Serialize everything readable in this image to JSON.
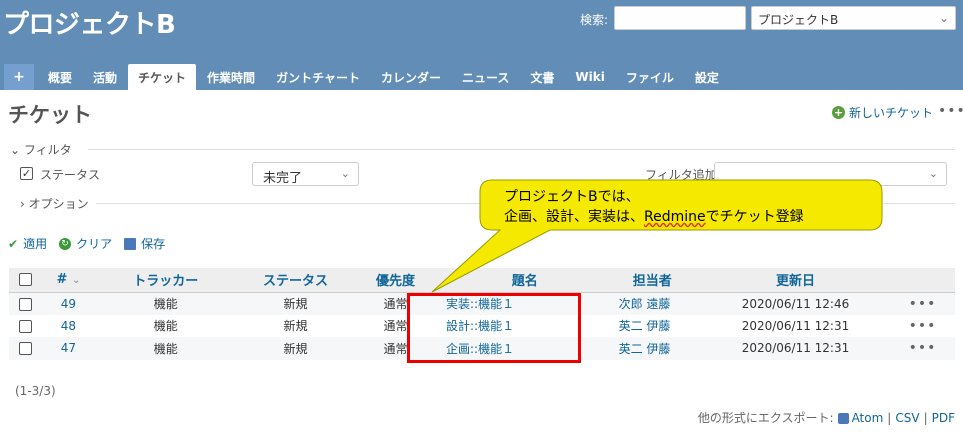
{
  "header": {
    "project_title": "プロジェクトB",
    "search_label": "検索:",
    "search_placeholder": "",
    "project_selector_value": "プロジェクトB"
  },
  "tabs": [
    {
      "label": "+"
    },
    {
      "label": "概要"
    },
    {
      "label": "活動"
    },
    {
      "label": "チケット",
      "selected": true
    },
    {
      "label": "作業時間"
    },
    {
      "label": "ガントチャート"
    },
    {
      "label": "カレンダー"
    },
    {
      "label": "ニュース"
    },
    {
      "label": "文書"
    },
    {
      "label": "Wiki"
    },
    {
      "label": "ファイル"
    },
    {
      "label": "設定"
    }
  ],
  "page": {
    "title": "チケット",
    "new_ticket_label": "新しいチケット"
  },
  "filters": {
    "legend": "フィルタ",
    "status_label": "ステータス",
    "status_value": "未完了",
    "add_filter_label": "フィルタ追加",
    "options_legend": "オプション"
  },
  "actions": {
    "apply": "適用",
    "clear": "クリア",
    "save": "保存"
  },
  "table": {
    "headers": {
      "id": "#",
      "tracker": "トラッカー",
      "status": "ステータス",
      "priority": "優先度",
      "subject": "題名",
      "assignee": "担当者",
      "updated": "更新日"
    },
    "rows": [
      {
        "id": "49",
        "tracker": "機能",
        "status": "新規",
        "priority": "通常",
        "subject": "実装::機能１",
        "assignee": "次郎 遠藤",
        "updated": "2020/06/11 12:46"
      },
      {
        "id": "48",
        "tracker": "機能",
        "status": "新規",
        "priority": "通常",
        "subject": "設計::機能１",
        "assignee": "英二 伊藤",
        "updated": "2020/06/11 12:31"
      },
      {
        "id": "47",
        "tracker": "機能",
        "status": "新規",
        "priority": "通常",
        "subject": "企画::機能１",
        "assignee": "英二 伊藤",
        "updated": "2020/06/11 12:31"
      }
    ]
  },
  "pagination": "(1-3/3)",
  "export": {
    "label": "他の形式にエクスポート:",
    "atom": "Atom",
    "csv": "CSV",
    "pdf": "PDF",
    "sep": "|"
  },
  "callout": {
    "line1": "プロジェクトBでは、",
    "line2_pre": "企画、設計、実装は、",
    "line2_underlined": "Redmine",
    "line2_post": "でチケット登録"
  },
  "colors": {
    "header_bg": "#628DB6",
    "link": "#116699",
    "callout_fill": "#F5E900",
    "highlight_box": "#E00000"
  }
}
